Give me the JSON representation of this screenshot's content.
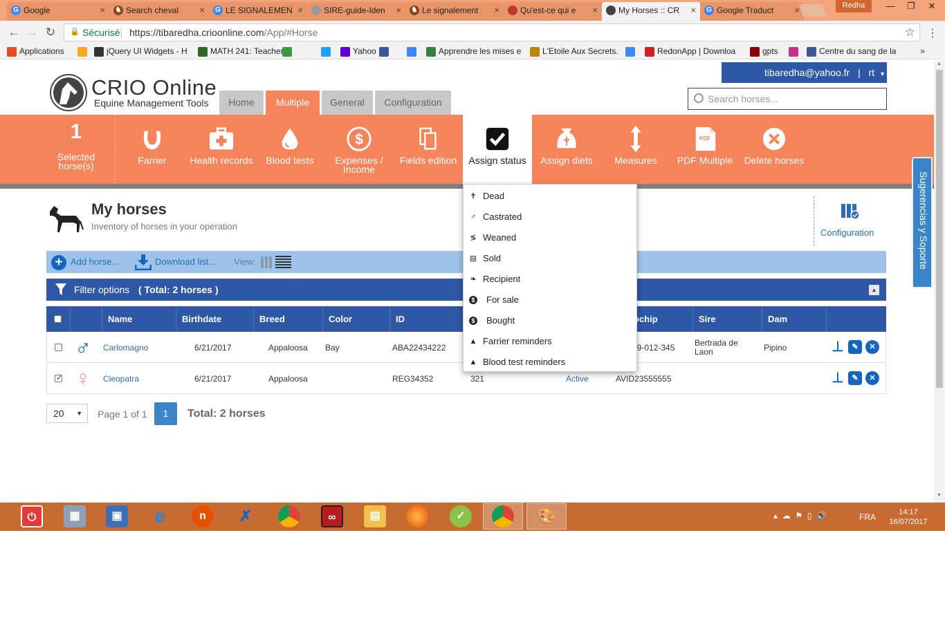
{
  "browser": {
    "tabs": [
      {
        "title": "Google",
        "icon_color": "#4285f4",
        "icon_letter": "G"
      },
      {
        "title": "Search cheval",
        "icon_color": "#8b4513",
        "icon_letter": "♞"
      },
      {
        "title": "LE SIGNALEMEN",
        "icon_color": "#4285f4",
        "icon_letter": "G"
      },
      {
        "title": "SIRE-guide-Iden",
        "icon_color": "#999999",
        "icon_letter": ""
      },
      {
        "title": "Le signalement",
        "icon_color": "#8b4513",
        "icon_letter": "♞"
      },
      {
        "title": "Qu'est-ce qui e",
        "icon_color": "#c0392b",
        "icon_letter": ""
      },
      {
        "title": "My Horses :: CR",
        "icon_color": "#444444",
        "icon_letter": ""
      },
      {
        "title": "Google Traduct",
        "icon_color": "#4285f4",
        "icon_letter": "G"
      }
    ],
    "profile": "Redha",
    "secure_label": "Sécurisé",
    "url_host": "https://tibaredha.crioonline.com",
    "url_path": "/App/#Horse",
    "bookmarks": [
      {
        "label": "Applications",
        "icon_color": "#e44d26"
      },
      {
        "label": "",
        "icon_color": "#f5a623"
      },
      {
        "label": "jQuery UI Widgets - H",
        "icon_color": "#333333"
      },
      {
        "label": "MATH 241: Teacher B",
        "icon_color": "#2d6a2d"
      },
      {
        "label": "",
        "icon_color": "#3c9a3c"
      },
      {
        "label": "",
        "icon_color": "#1da1f2"
      },
      {
        "label": "Yahoo",
        "icon_color": "#5f01d1"
      },
      {
        "label": "",
        "icon_color": "#3b5998"
      },
      {
        "label": "",
        "icon_color": "#4285f4"
      },
      {
        "label": "Apprendre les mises e",
        "icon_color": "#3a7d44"
      },
      {
        "label": "L'Etoile Aux Secrets.",
        "icon_color": "#b8860b"
      },
      {
        "label": "",
        "icon_color": "#4285f4"
      },
      {
        "label": "RedonApp | Downloa",
        "icon_color": "#cc2222"
      },
      {
        "label": "gpts",
        "icon_color": "#8b0000"
      },
      {
        "label": "",
        "icon_color": "#c13584"
      },
      {
        "label": "Centre du sang de la",
        "icon_color": "#3b5998"
      }
    ]
  },
  "header": {
    "logo_title": "CRIO Online",
    "logo_subtitle": "Equine Management Tools",
    "nav": [
      "Home",
      "Multiple",
      "General",
      "Configuration"
    ],
    "active_nav": "Multiple",
    "user_email": "tibaredha@yahoo.fr",
    "user_sep": "|",
    "user_short": "rt",
    "search_placeholder": "Search horses..."
  },
  "actions": {
    "selected_count": "1",
    "selected_label_1": "Selected",
    "selected_label_2": "horse(s)",
    "items": [
      {
        "label": "Farrier",
        "icon": "horseshoe-icon"
      },
      {
        "label": "Health records",
        "icon": "first-aid-kit-icon"
      },
      {
        "label": "Blood tests",
        "icon": "blood-drop-icon"
      },
      {
        "label": "Expenses /",
        "label2": "Income",
        "icon": "dollar-icon"
      },
      {
        "label": "Fields edition",
        "icon": "copy-icon"
      },
      {
        "label": "Assign status",
        "icon": "checkbox-icon"
      },
      {
        "label": "Assign diets",
        "icon": "feed-bag-icon"
      },
      {
        "label": "Measures",
        "icon": "vertical-arrow-icon"
      },
      {
        "label": "PDF Multiple",
        "icon": "pdf-icon"
      },
      {
        "label": "Delete horses",
        "icon": "delete-circle-icon"
      }
    ],
    "pdf_icon_text": "PDF"
  },
  "status_menu": [
    {
      "label": "Dead",
      "icon": "cross-icon",
      "glyph": "✝"
    },
    {
      "label": "Castrated",
      "icon": "male-icon",
      "glyph": "♂"
    },
    {
      "label": "Weaned",
      "icon": "split-icon",
      "glyph": "≶"
    },
    {
      "label": "Sold",
      "icon": "sold-icon",
      "glyph": "▤"
    },
    {
      "label": "Recipient",
      "icon": "recipient-icon",
      "glyph": "❧"
    },
    {
      "label": "For sale",
      "icon": "for-sale-icon",
      "glyph": "$"
    },
    {
      "label": "Bought",
      "icon": "bought-icon",
      "glyph": "$"
    },
    {
      "label": "Farrier reminders",
      "icon": "bell-icon",
      "glyph": "▲"
    },
    {
      "label": "Blood test reminders",
      "icon": "bell-icon",
      "glyph": "▲"
    }
  ],
  "main": {
    "title": "My horses",
    "subtitle": "Inventory of horses in your operation",
    "config_label": "Configuration",
    "add_horse": "Add horse...",
    "download_list": "Download list...",
    "view_label": "View:",
    "filter_label": "Filter options",
    "filter_total": "( Total: 2 horses )"
  },
  "table": {
    "columns": [
      "Name",
      "Birthdate",
      "Breed",
      "Color",
      "ID",
      "",
      "",
      "ochip",
      "Sire",
      "Dam"
    ],
    "rows": [
      {
        "checked": false,
        "sex": "male",
        "sex_color": "#1565c0",
        "name": "Carlomagno",
        "birthdate": "6/21/2017",
        "breed": "Appaloosa",
        "color": "Bay",
        "id": "ABA22434222",
        "col6": "",
        "status": "",
        "microchip": "56-789-012-345",
        "sire": "Bertrada de Laon",
        "dam": "Pipino"
      },
      {
        "checked": true,
        "sex": "female",
        "sex_color": "#f48fb1",
        "name": "Cleopatra",
        "birthdate": "6/21/2017",
        "breed": "Appaloosa",
        "color": "",
        "id": "REG34352",
        "col6": "321",
        "status": "Active",
        "microchip": "AVID23555555",
        "sire": "",
        "dam": ""
      }
    ]
  },
  "pagination": {
    "page_size": "20",
    "page_text": "Page 1 of 1",
    "current": "1",
    "total": "Total: 2 horses"
  },
  "support_label": "Sugerencias y Soporte",
  "taskbar": {
    "lang": "FRA",
    "time": "14:17",
    "date": "16/07/2017"
  }
}
